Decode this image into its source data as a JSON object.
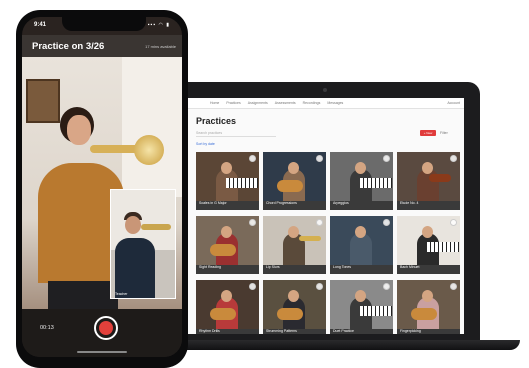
{
  "phone": {
    "status_time": "9:41",
    "status_icons": "▪▪▪ ◠ ▮",
    "title": "Practice on 3/26",
    "subtitle": "17 mins available",
    "pip_label": "Teacher",
    "timer": "00:13"
  },
  "laptop": {
    "nav": [
      "Home",
      "Practices",
      "Assignments",
      "Assessments",
      "Recordings",
      "Messages"
    ],
    "nav_right": "Account",
    "page_title": "Practices",
    "search_placeholder": "Search practices",
    "sort_label": "Sort by date",
    "new_button": "+ New",
    "filter_button": "Filter",
    "cards": [
      {
        "caption": "Scales in G Major",
        "bg": "#5b4636",
        "person": "#7a5a44",
        "instr": "piano"
      },
      {
        "caption": "Chord Progressions",
        "bg": "#2f3b4a",
        "person": "#8a6a50",
        "instr": "guitar"
      },
      {
        "caption": "Arpeggios",
        "bg": "#6b6b6b",
        "person": "#3a3a3a",
        "instr": "piano"
      },
      {
        "caption": "Etude No. 4",
        "bg": "#5a4a40",
        "person": "#6a4030",
        "instr": "violin"
      },
      {
        "caption": "Sight Reading",
        "bg": "#7a6a5a",
        "person": "#9a3030",
        "instr": "guitar"
      },
      {
        "caption": "Lip Slurs",
        "bg": "#c9c2b8",
        "person": "#5a4a3a",
        "instr": "trumpet"
      },
      {
        "caption": "Long Tones",
        "bg": "#3a4a5a",
        "person": "#4a5a6a",
        "instr": "none"
      },
      {
        "caption": "Bach Minuet",
        "bg": "#e8e4de",
        "person": "#2a2a2a",
        "instr": "piano"
      },
      {
        "caption": "Rhythm Drills",
        "bg": "#4a3a30",
        "person": "#b83a3a",
        "instr": "guitar"
      },
      {
        "caption": "Strumming Patterns",
        "bg": "#5a5040",
        "person": "#2a2a30",
        "instr": "guitar"
      },
      {
        "caption": "Duet Practice",
        "bg": "#8a8a8a",
        "person": "#3a3a3a",
        "instr": "piano"
      },
      {
        "caption": "Fingerpicking",
        "bg": "#6a5a4a",
        "person": "#c9a0a0",
        "instr": "guitar"
      }
    ]
  }
}
